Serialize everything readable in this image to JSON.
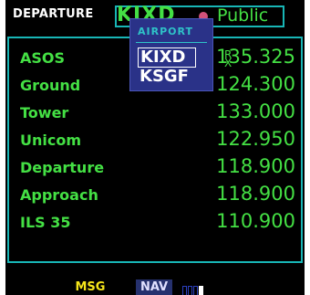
{
  "header": {
    "page_label": "DEPARTURE",
    "ident": "KIXD",
    "type": "Public"
  },
  "popup": {
    "title": "AIRPORT",
    "items": [
      "KIXD",
      "KSGF"
    ]
  },
  "rx_mark": "R\nX",
  "frequencies": [
    {
      "name": "ASOS",
      "value": "135.325"
    },
    {
      "name": "Ground",
      "value": "124.300"
    },
    {
      "name": "Tower",
      "value": "133.000"
    },
    {
      "name": "Unicom",
      "value": "122.950"
    },
    {
      "name": "Departure",
      "value": "118.900"
    },
    {
      "name": "Approach",
      "value": "118.900"
    },
    {
      "name": "ILS 35",
      "value": "110.900"
    }
  ],
  "status": {
    "msg": "MSG",
    "nav": "NAV",
    "signal_level": 0.25
  },
  "colors": {
    "text_green": "#44e044",
    "frame_cyan": "#18b6b6",
    "popup_blue": "#2a3288",
    "msg_yellow": "#f5e51a"
  }
}
